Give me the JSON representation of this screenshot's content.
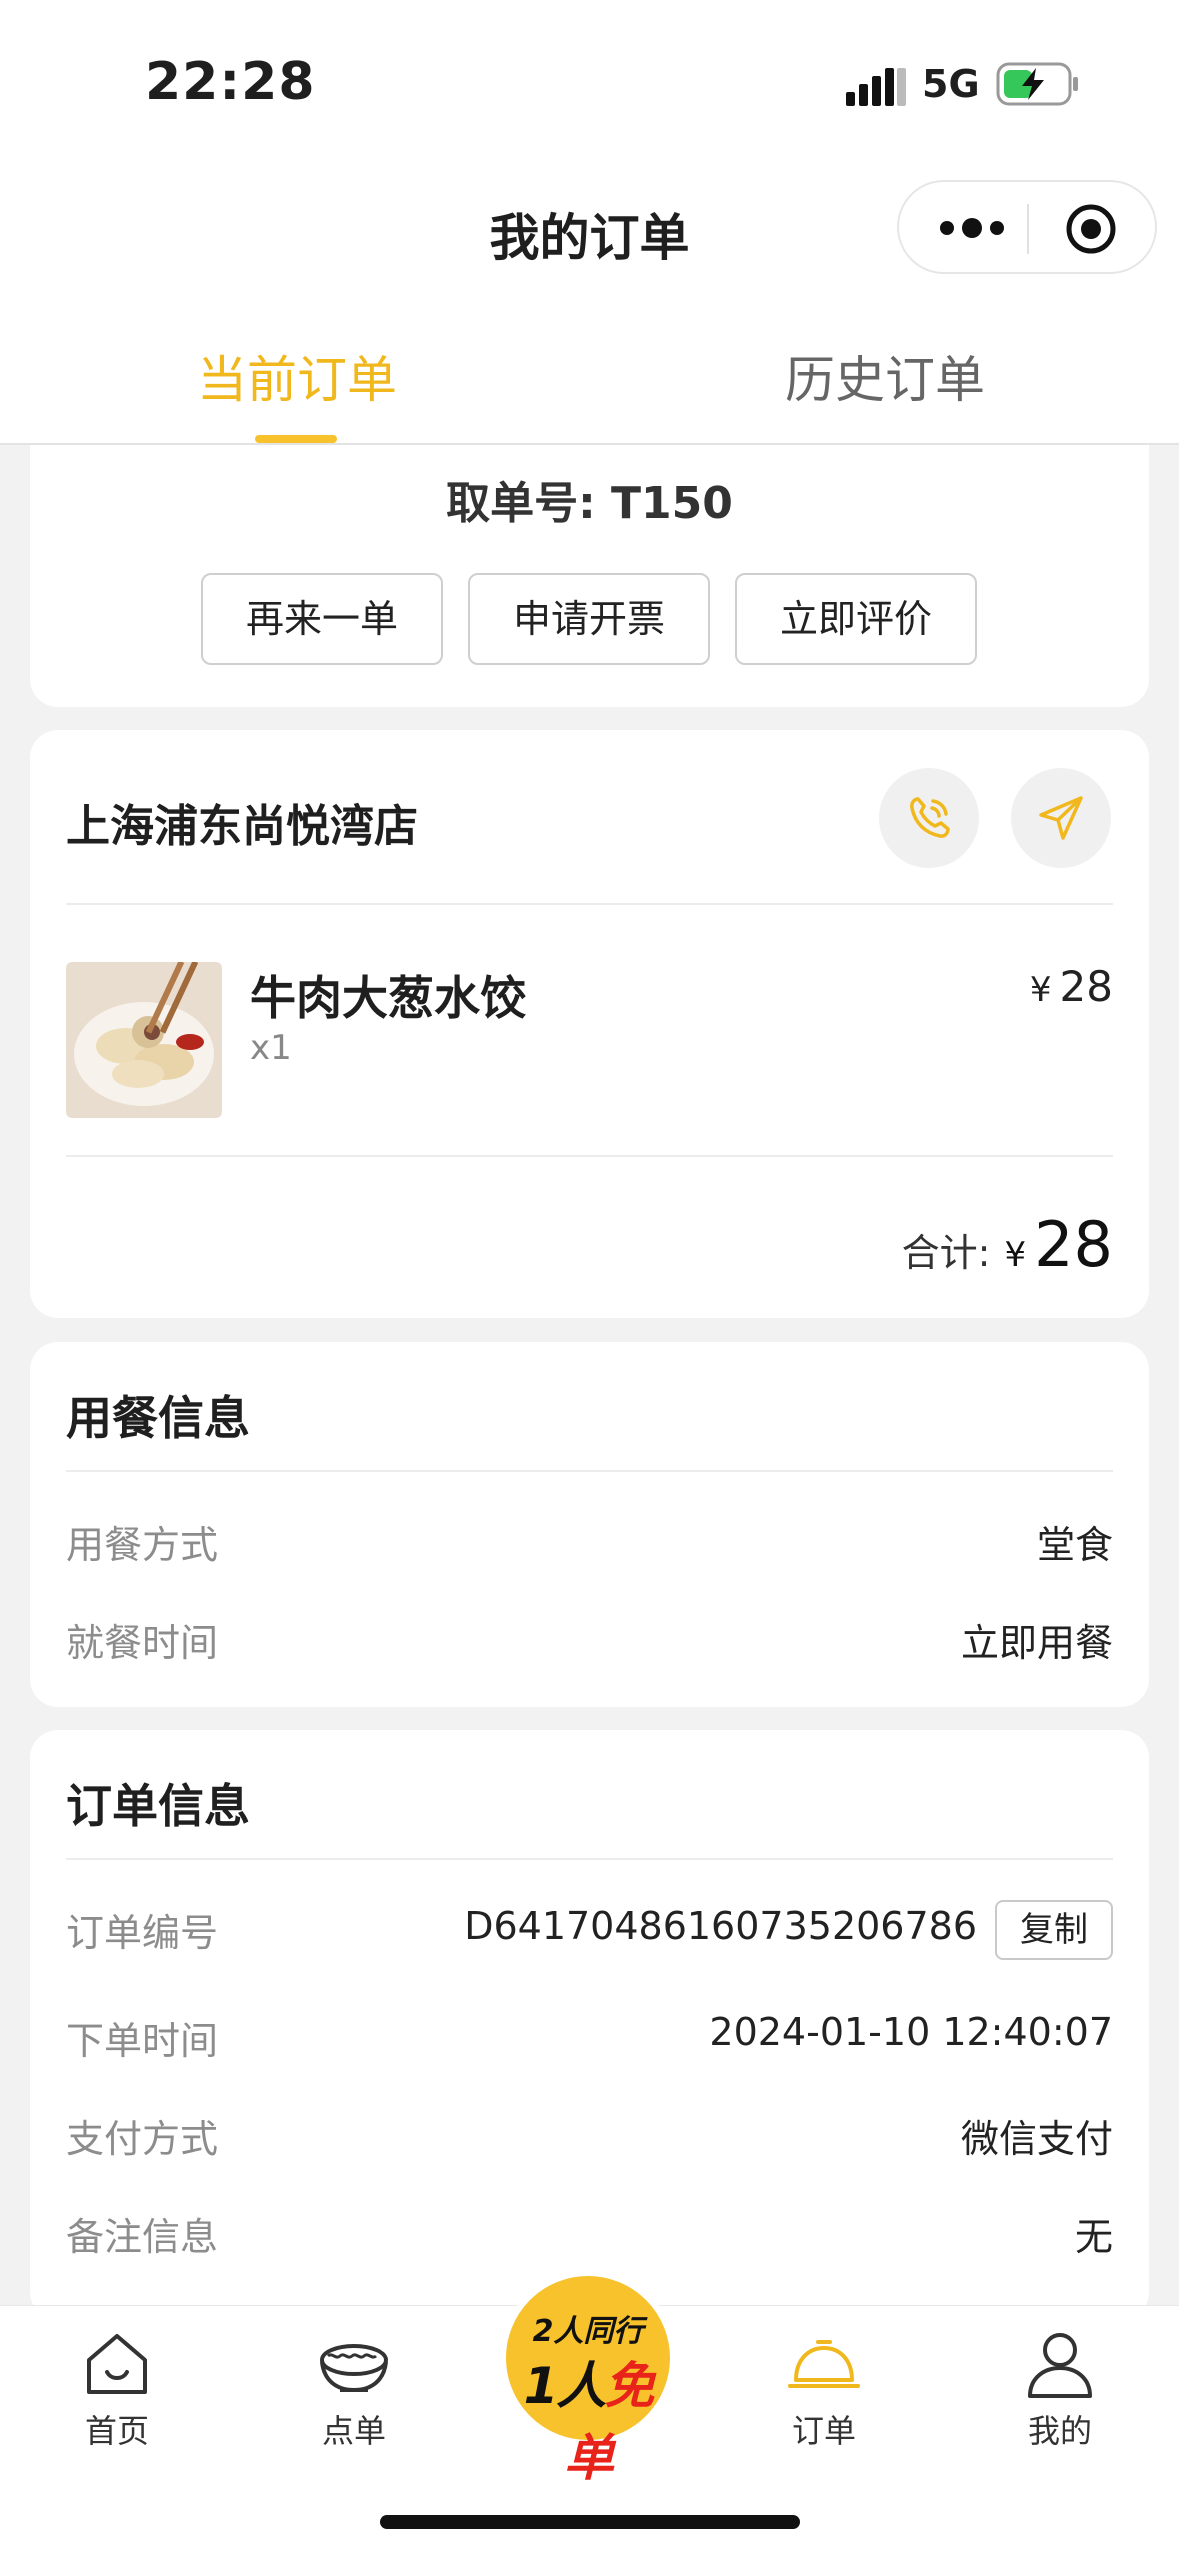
{
  "status_bar": {
    "time": "22:28",
    "network": "5G"
  },
  "header": {
    "title": "我的订单"
  },
  "tabs": [
    {
      "label": "当前订单",
      "active": true
    },
    {
      "label": "历史订单",
      "active": false
    }
  ],
  "order_summary": {
    "pickup_number": "取单号: T150",
    "buttons": [
      "再来一单",
      "申请开票",
      "立即评价"
    ]
  },
  "store": {
    "name": "上海浦东尚悦湾店",
    "phone_icon": "phone-icon",
    "navigate_icon": "navigate-icon",
    "items": [
      {
        "name": "牛肉大葱水饺",
        "qty": "x1",
        "currency": "¥",
        "price": "28"
      }
    ],
    "total_label": "合计:",
    "total_currency": "¥",
    "total_value": "28"
  },
  "dining_info": {
    "title": "用餐信息",
    "rows": [
      {
        "label": "用餐方式",
        "value": "堂食"
      },
      {
        "label": "就餐时间",
        "value": "立即用餐"
      }
    ]
  },
  "order_info": {
    "title": "订单信息",
    "copy_label": "复制",
    "rows": [
      {
        "label": "订单编号",
        "value": "D6417048616073520678​6"
      },
      {
        "label": "下单时间",
        "value": "2024-01-10 12:40:07"
      },
      {
        "label": "支付方式",
        "value": "微信支付"
      },
      {
        "label": "备注信息",
        "value": "无"
      }
    ]
  },
  "bottom_nav": {
    "items": [
      "首页",
      "点单",
      "订单",
      "我的"
    ],
    "promo_line1": "2人同行",
    "promo_line2_a": "1人",
    "promo_line2_b": "免单"
  },
  "colors": {
    "accent": "#f7c22c",
    "accent_text": "#f1b81d"
  }
}
